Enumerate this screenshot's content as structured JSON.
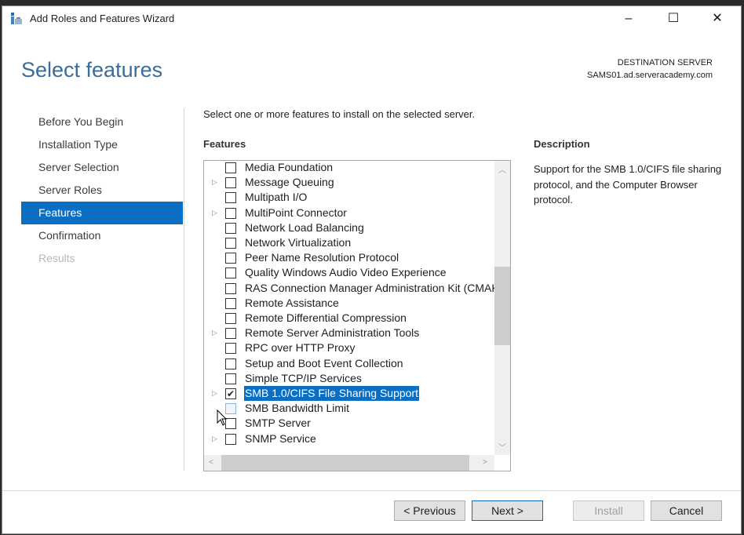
{
  "window": {
    "title": "Add Roles and Features Wizard",
    "minimize": "–",
    "maximize": "☐",
    "close": "✕"
  },
  "page": {
    "heading": "Select features",
    "destination_label": "DESTINATION SERVER",
    "destination_server": "SAMS01.ad.serveracademy.com",
    "intro": "Select one or more features to install on the selected server."
  },
  "nav": [
    {
      "label": "Before You Begin",
      "state": "normal"
    },
    {
      "label": "Installation Type",
      "state": "normal"
    },
    {
      "label": "Server Selection",
      "state": "normal"
    },
    {
      "label": "Server Roles",
      "state": "normal"
    },
    {
      "label": "Features",
      "state": "selected"
    },
    {
      "label": "Confirmation",
      "state": "normal"
    },
    {
      "label": "Results",
      "state": "disabled"
    }
  ],
  "features": {
    "label": "Features",
    "items": [
      {
        "label": "Media Foundation",
        "expandable": false,
        "checked": false
      },
      {
        "label": "Message Queuing",
        "expandable": true,
        "checked": false
      },
      {
        "label": "Multipath I/O",
        "expandable": false,
        "checked": false
      },
      {
        "label": "MultiPoint Connector",
        "expandable": true,
        "checked": false
      },
      {
        "label": "Network Load Balancing",
        "expandable": false,
        "checked": false
      },
      {
        "label": "Network Virtualization",
        "expandable": false,
        "checked": false
      },
      {
        "label": "Peer Name Resolution Protocol",
        "expandable": false,
        "checked": false
      },
      {
        "label": "Quality Windows Audio Video Experience",
        "expandable": false,
        "checked": false
      },
      {
        "label": "RAS Connection Manager Administration Kit (CMAK)",
        "expandable": false,
        "checked": false
      },
      {
        "label": "Remote Assistance",
        "expandable": false,
        "checked": false
      },
      {
        "label": "Remote Differential Compression",
        "expandable": false,
        "checked": false
      },
      {
        "label": "Remote Server Administration Tools",
        "expandable": true,
        "checked": false
      },
      {
        "label": "RPC over HTTP Proxy",
        "expandable": false,
        "checked": false
      },
      {
        "label": "Setup and Boot Event Collection",
        "expandable": false,
        "checked": false
      },
      {
        "label": "Simple TCP/IP Services",
        "expandable": false,
        "checked": false
      },
      {
        "label": "SMB 1.0/CIFS File Sharing Support",
        "expandable": true,
        "checked": true,
        "selected": true
      },
      {
        "label": "SMB Bandwidth Limit",
        "expandable": false,
        "checked": false,
        "hover": true
      },
      {
        "label": "SMTP Server",
        "expandable": false,
        "checked": false
      },
      {
        "label": "SNMP Service",
        "expandable": true,
        "checked": false
      }
    ]
  },
  "description": {
    "label": "Description",
    "text": "Support for the SMB 1.0/CIFS file sharing protocol, and the Computer Browser protocol."
  },
  "buttons": {
    "previous": "< Previous",
    "next": "Next >",
    "install": "Install",
    "cancel": "Cancel"
  }
}
